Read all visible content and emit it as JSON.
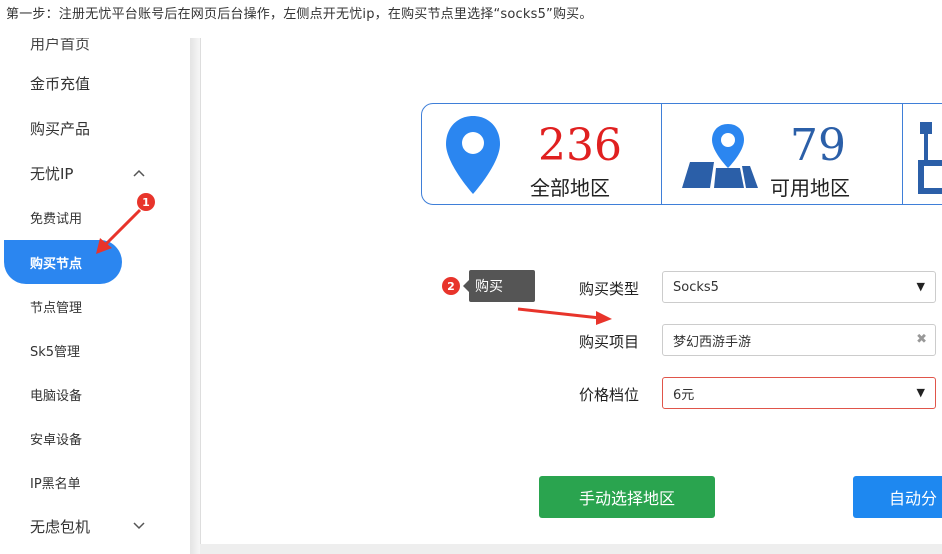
{
  "caption": "第一步：注册无忧平台账号后在网页后台操作，左侧点开无忧ip，在购买节点里选择“socks5”购买。",
  "sidebar": {
    "partial_item": "用户首页",
    "items": [
      {
        "label": "金币充值"
      },
      {
        "label": "购买产品"
      },
      {
        "label": "无忧IP",
        "chevron": "^"
      },
      {
        "label": "免费试用"
      },
      {
        "label": "购买节点"
      },
      {
        "label": "节点管理"
      },
      {
        "label": "Sk5管理"
      },
      {
        "label": "电脑设备"
      },
      {
        "label": "安卓设备"
      },
      {
        "label": "IP黑名单"
      },
      {
        "label": "无虑包机",
        "chevron": "v"
      }
    ]
  },
  "stats": {
    "all_regions": {
      "value": "236",
      "label": "全部地区",
      "color": "#e02020"
    },
    "available_regions": {
      "value": "79",
      "label": "可用地区",
      "color": "#2b5fa8"
    }
  },
  "form": {
    "type_label": "购买类型",
    "type_value": "Socks5",
    "project_label": "购买项目",
    "project_value": "梦幻西游手游",
    "price_label": "价格档位",
    "price_value": "6元"
  },
  "buttons": {
    "manual": "手动选择地区",
    "auto": "自动分"
  },
  "annotations": {
    "badge1": "1",
    "badge2": "2",
    "tooltip": "购买"
  },
  "colors": {
    "accent": "#2b86f0",
    "green": "#2aa44f",
    "blue_btn": "#1e88f0",
    "red_annotation": "#e8342b"
  }
}
